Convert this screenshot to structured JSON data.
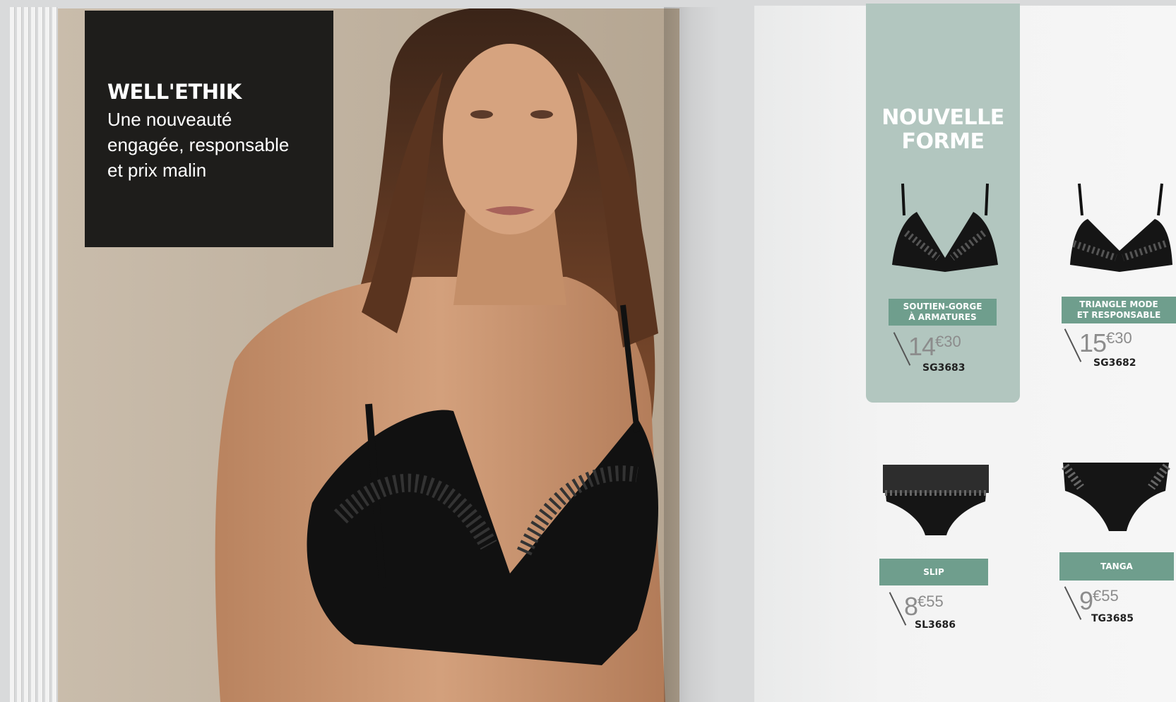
{
  "left_page": {
    "title": "WELL'ETHIK",
    "tagline": "Une nouveauté\nengagée, responsable\net prix malin"
  },
  "right_page": {
    "highlight": "NOUVELLE\nFORME",
    "products": [
      {
        "label": "SOUTIEN-GORGE\nÀ ARMATURES",
        "price_euros": "14",
        "price_cents": "€30",
        "ref": "SG3683"
      },
      {
        "label": "TRIANGLE MODE\nET RESPONSABLE",
        "price_euros": "15",
        "price_cents": "€30",
        "ref": "SG3682"
      },
      {
        "label": "SLIP",
        "price_euros": "8",
        "price_cents": "€55",
        "ref": "SL3686"
      },
      {
        "label": "TANGA",
        "price_euros": "9",
        "price_cents": "€55",
        "ref": "TG3685"
      }
    ]
  },
  "colors": {
    "accent_panel": "#b2c6bf",
    "label_green": "#6f9e8d",
    "title_box": "#1e1d1b"
  },
  "icons": [
    "model-photo",
    "bra-underwire-icon",
    "triangle-bra-icon",
    "slip-icon",
    "tanga-icon"
  ]
}
